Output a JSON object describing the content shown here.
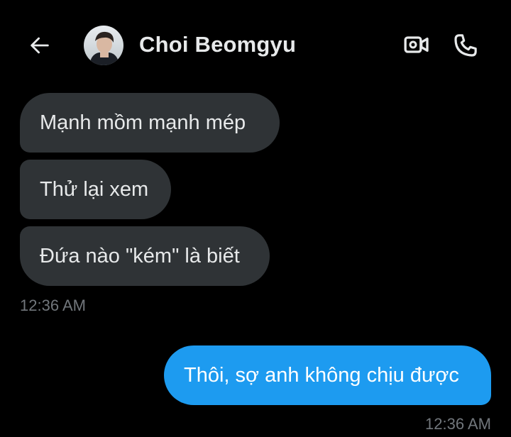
{
  "header": {
    "back_icon": "arrow-left-icon",
    "contact_name": "Choi Beomgyu",
    "video_icon": "video-camera-icon",
    "call_icon": "phone-icon"
  },
  "colors": {
    "background": "#000000",
    "incoming_bubble": "#2f3336",
    "outgoing_bubble": "#1d9bf0",
    "timestamp": "#71767b"
  },
  "messages": [
    {
      "direction": "incoming",
      "text": "Mạnh mồm mạnh mép"
    },
    {
      "direction": "incoming",
      "text": "Thử lại xem"
    },
    {
      "direction": "incoming",
      "text": "Đứa nào \"kém\" là biết"
    },
    {
      "direction": "outgoing",
      "text": "Thôi, sợ anh không chịu được"
    }
  ],
  "timestamps": {
    "incoming": "12:36 AM",
    "outgoing": "12:36 AM"
  }
}
